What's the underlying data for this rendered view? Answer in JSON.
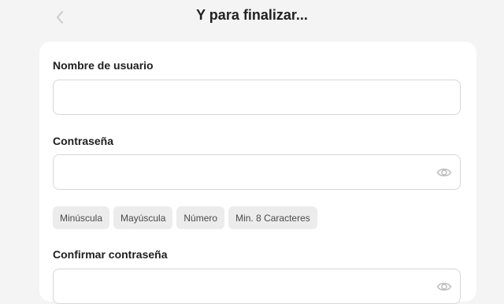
{
  "header": {
    "back_icon": "chevron-left-icon",
    "title": "Y para finalizar..."
  },
  "form": {
    "username": {
      "label": "Nombre de usuario",
      "value": "",
      "placeholder": ""
    },
    "password": {
      "label": "Contraseña",
      "value": "",
      "placeholder": "",
      "toggle_icon": "eye-icon"
    },
    "requirements": [
      "Minúscula",
      "Mayúscula",
      "Número",
      "Min. 8 Caracteres"
    ],
    "confirm_password": {
      "label": "Confirmar contraseña",
      "value": "",
      "placeholder": "",
      "toggle_icon": "eye-icon"
    }
  },
  "colors": {
    "background": "#f4f4f4",
    "card": "#ffffff",
    "chip": "#ececec",
    "border": "#d7d7d7"
  }
}
